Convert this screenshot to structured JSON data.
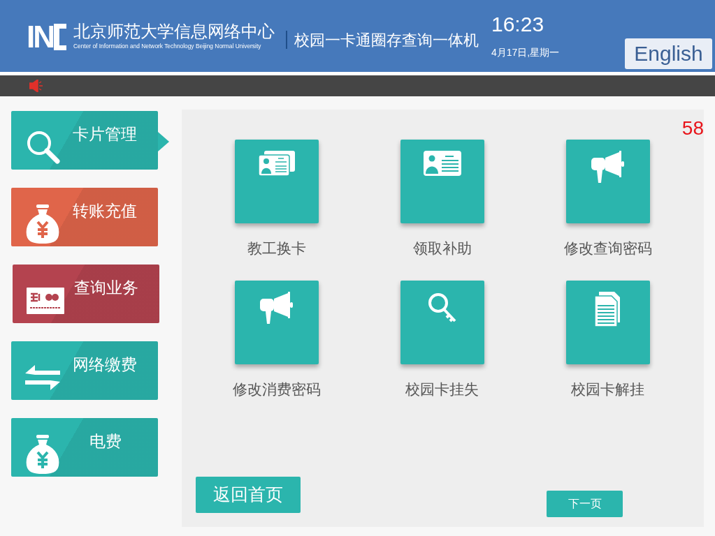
{
  "header": {
    "logo_letters": "IN",
    "org_name": "北京师范大学信息网络中心",
    "org_name_en": "Center of Information and Network Technology Beijing Normal University",
    "title": "校园一卡通圈存查询一体机",
    "time": "16:23",
    "date": "4月17日,星期一",
    "language_button": "English"
  },
  "sidebar": {
    "items": [
      {
        "label": "卡片管理",
        "kind": "search",
        "color": "#2bb5ad",
        "selected": true
      },
      {
        "label": "转账充值",
        "kind": "money",
        "color": "#e0654a",
        "selected": false
      },
      {
        "label": "查询业务",
        "kind": "card",
        "color": "#b4434f",
        "selected": false
      },
      {
        "label": "网络缴费",
        "kind": "transfer",
        "color": "#2bb5ad",
        "selected": false
      },
      {
        "label": "电费",
        "kind": "money",
        "color": "#2bb5ad",
        "selected": false
      }
    ]
  },
  "main": {
    "countdown": "58",
    "tiles": [
      {
        "label": "教工换卡",
        "kind": "cards"
      },
      {
        "label": "领取补助",
        "kind": "idcard"
      },
      {
        "label": "修改查询密码",
        "kind": "megaphone"
      },
      {
        "label": "修改消费密码",
        "kind": "megaphone"
      },
      {
        "label": "校园卡挂失",
        "kind": "key"
      },
      {
        "label": "校园卡解挂",
        "kind": "document"
      }
    ],
    "home_button": "返回首页",
    "next_button": "下一页"
  }
}
